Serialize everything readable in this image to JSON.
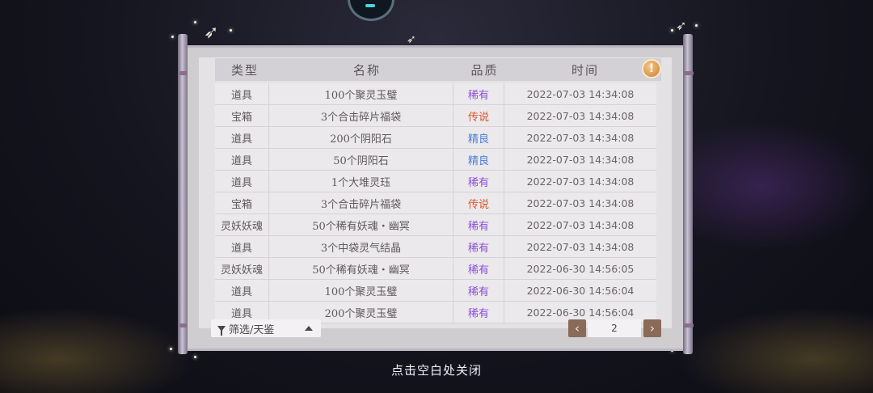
{
  "columns": {
    "type": "类型",
    "name": "名称",
    "quality": "品质",
    "time": "时间"
  },
  "rows": [
    {
      "type": "道具",
      "name": "100个聚灵玉璧",
      "quality": "稀有",
      "time": "2022-07-03  14:34:08"
    },
    {
      "type": "宝箱",
      "name": "3个合击碎片福袋",
      "quality": "传说",
      "time": "2022-07-03  14:34:08"
    },
    {
      "type": "道具",
      "name": "200个阴阳石",
      "quality": "精良",
      "time": "2022-07-03  14:34:08"
    },
    {
      "type": "道具",
      "name": "50个阴阳石",
      "quality": "精良",
      "time": "2022-07-03  14:34:08"
    },
    {
      "type": "道具",
      "name": "1个大堆灵珏",
      "quality": "稀有",
      "time": "2022-07-03  14:34:08"
    },
    {
      "type": "宝箱",
      "name": "3个合击碎片福袋",
      "quality": "传说",
      "time": "2022-07-03  14:34:08"
    },
    {
      "type": "灵妖妖魂",
      "name": "50个稀有妖魂・幽冥",
      "quality": "稀有",
      "time": "2022-07-03  14:34:08"
    },
    {
      "type": "道具",
      "name": "3个中袋灵气结晶",
      "quality": "稀有",
      "time": "2022-07-03  14:34:08"
    },
    {
      "type": "灵妖妖魂",
      "name": "50个稀有妖魂・幽冥",
      "quality": "稀有",
      "time": "2022-06-30  14:56:05"
    },
    {
      "type": "道具",
      "name": "100个聚灵玉璧",
      "quality": "稀有",
      "time": "2022-06-30  14:56:04"
    },
    {
      "type": "道具",
      "name": "200个聚灵玉璧",
      "quality": "稀有",
      "time": "2022-06-30  14:56:04"
    }
  ],
  "quality_colors": {
    "稀有": "#8a4fd6",
    "传说": "#d4582e",
    "精良": "#4a7fd4"
  },
  "filter": {
    "label": "筛选/天鉴",
    "icon": "filter-icon",
    "toggle_icon": "caret-up-icon"
  },
  "pagination": {
    "page": "2",
    "prev_icon": "chevron-left-icon",
    "next_icon": "chevron-right-icon",
    "prev_symbol": "‹",
    "next_symbol": "›"
  },
  "info_button": {
    "symbol": "!",
    "icon": "alert-icon"
  },
  "close_hint": "点击空白处关闭"
}
